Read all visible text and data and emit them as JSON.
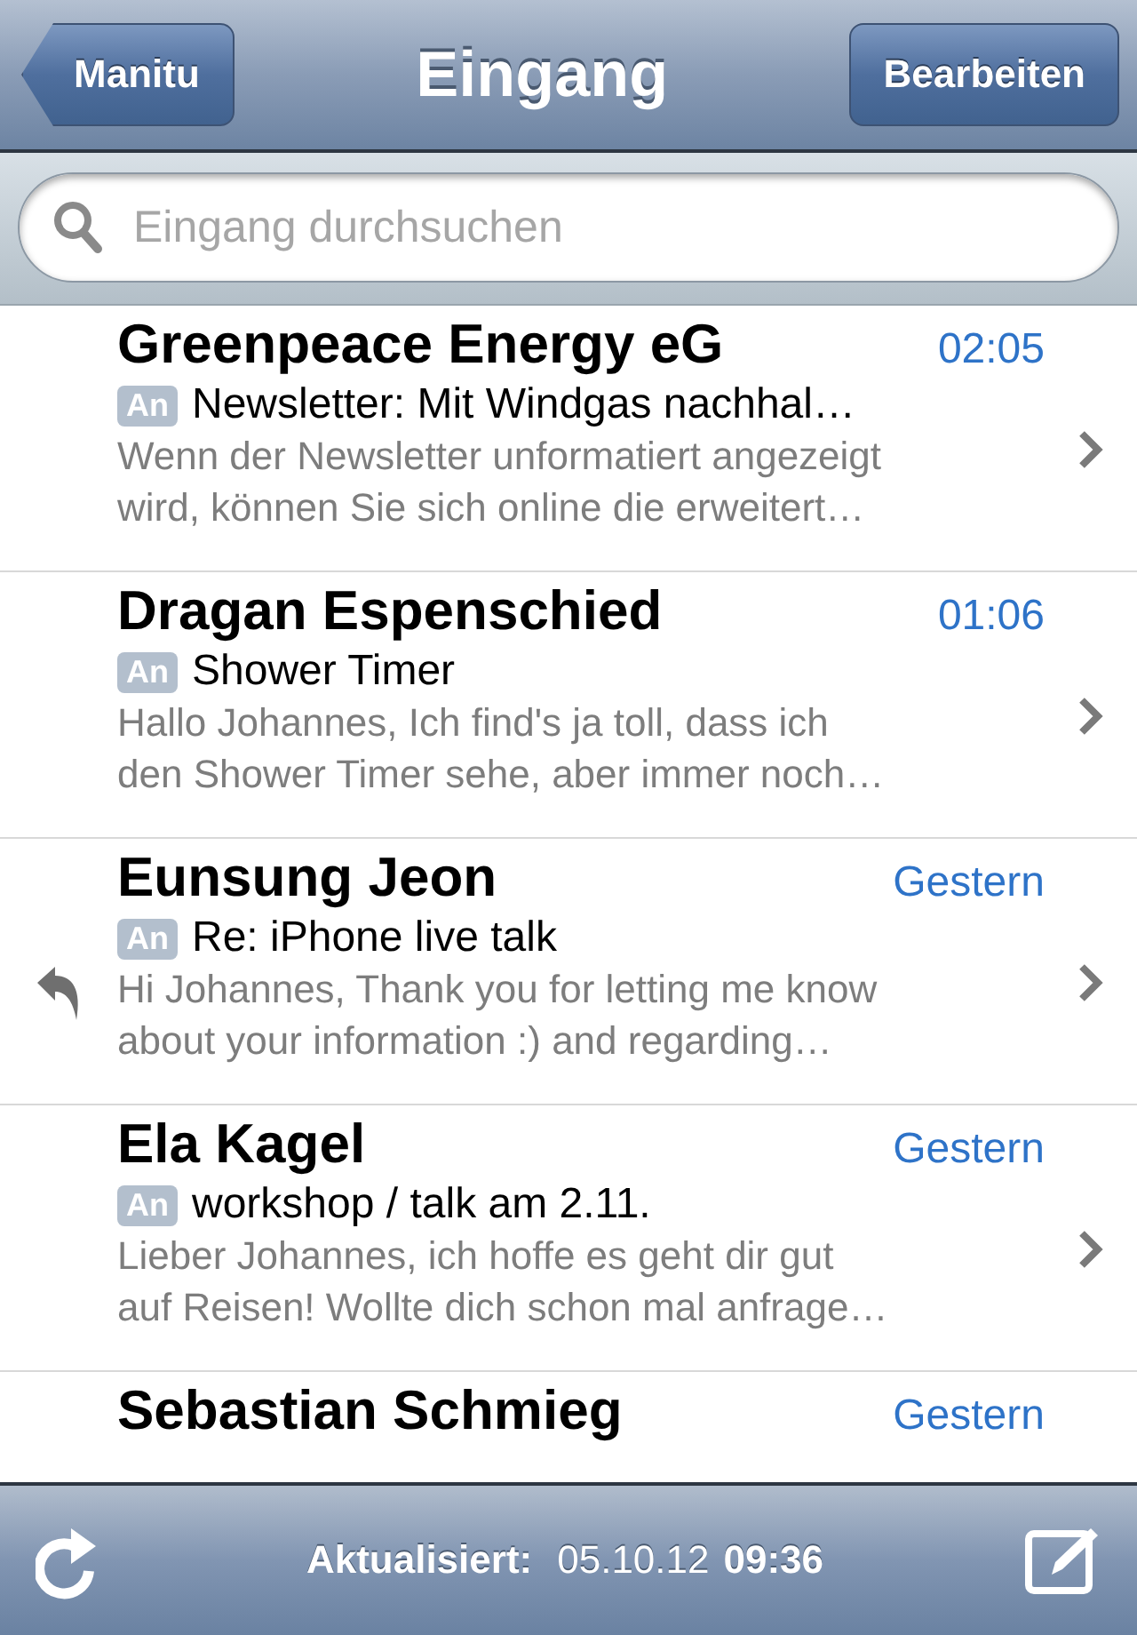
{
  "nav_bar": {
    "back_button": "Manitu",
    "title": "Eingang",
    "edit_button": "Bearbeiten"
  },
  "search": {
    "placeholder": "Eingang durchsuchen"
  },
  "messages": [
    {
      "sender": "Greenpeace Energy eG",
      "time": "02:05",
      "badge": "An",
      "subject": "Newsletter: Mit Windgas nachhal…",
      "preview": [
        "Wenn der Newsletter unformatiert angezeigt",
        "wird, können Sie sich online die erweitert…"
      ],
      "replied": false
    },
    {
      "sender": "Dragan Espenschied",
      "time": "01:06",
      "badge": "An",
      "subject": "Shower Timer",
      "preview": [
        "Hallo Johannes, Ich find's ja toll, dass ich",
        "den Shower Timer sehe, aber immer noch…"
      ],
      "replied": false
    },
    {
      "sender": "Eunsung Jeon",
      "time": "Gestern",
      "badge": "An",
      "subject": "Re: iPhone live talk",
      "preview": [
        "Hi Johannes, Thank you for letting me know",
        "about your information :) and regarding…"
      ],
      "replied": true
    },
    {
      "sender": "Ela Kagel",
      "time": "Gestern",
      "badge": "An",
      "subject": "workshop / talk am 2.11.",
      "preview": [
        "Lieber Johannes, ich hoffe es geht dir gut",
        "auf Reisen! Wollte dich schon mal anfrage…"
      ],
      "replied": false
    },
    {
      "sender": "Sebastian Schmieg",
      "time": "Gestern",
      "replied": false
    }
  ],
  "toolbar": {
    "label": "Aktualisiert:",
    "date": "05.10.12",
    "time": "09:36"
  }
}
